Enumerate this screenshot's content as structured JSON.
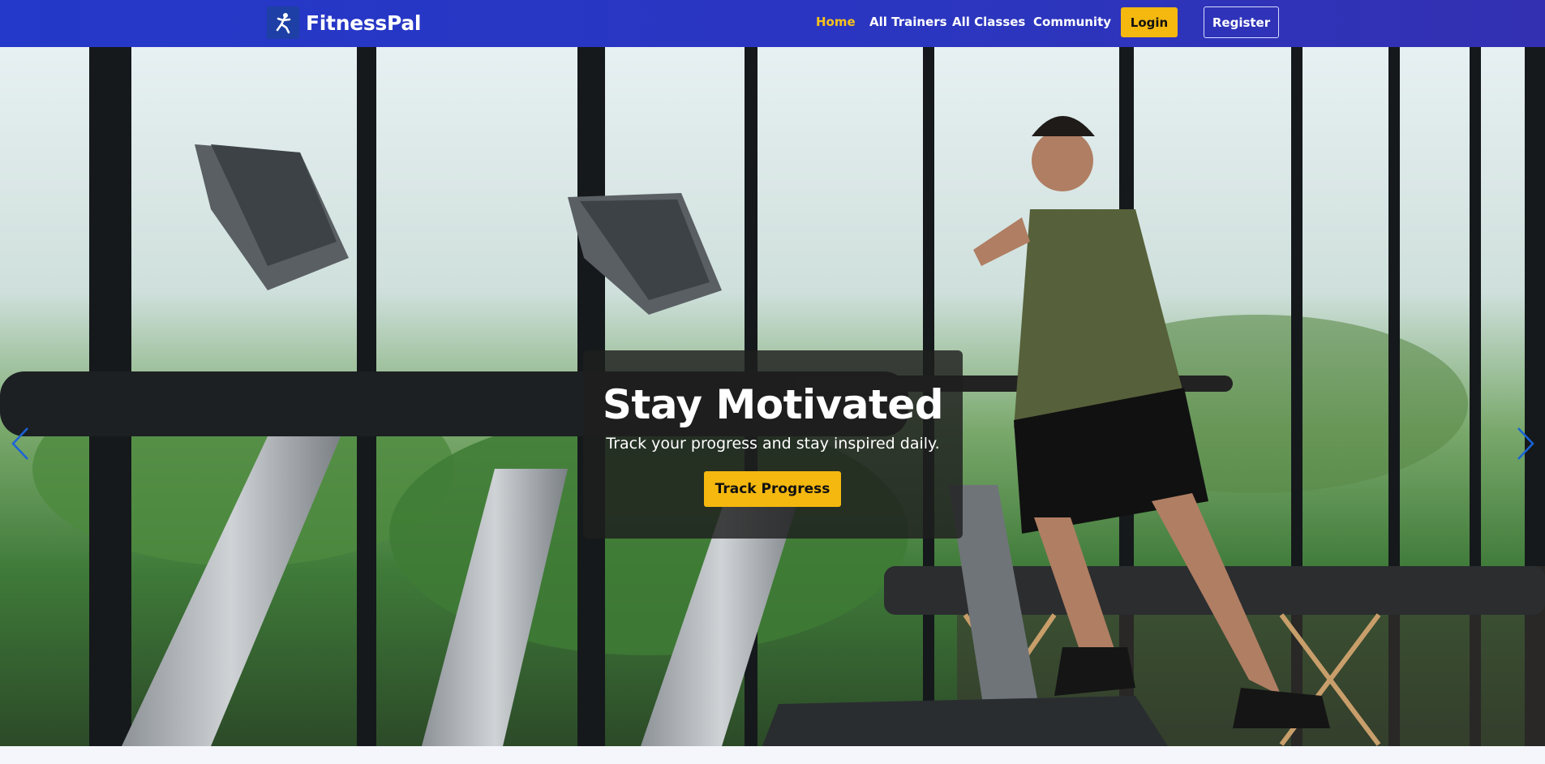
{
  "brand": {
    "name": "FitnessPal",
    "logo_icon": "runner-icon"
  },
  "nav": {
    "items": [
      {
        "label": "Home",
        "active": true
      },
      {
        "label": "All Trainers",
        "active": false
      },
      {
        "label": "All Classes",
        "active": false
      },
      {
        "label": "Community",
        "active": false
      }
    ],
    "login_label": "Login",
    "register_label": "Register"
  },
  "hero": {
    "title": "Stay Motivated",
    "subtitle": "Track your progress and stay inspired daily.",
    "cta_label": "Track Progress",
    "slides_count": 3,
    "active_slide": 3
  },
  "colors": {
    "nav_bg": "#2b36c0",
    "accent": "#f4b80f",
    "active_nav": "#f7c21b",
    "arrow": "#1a63d8"
  }
}
